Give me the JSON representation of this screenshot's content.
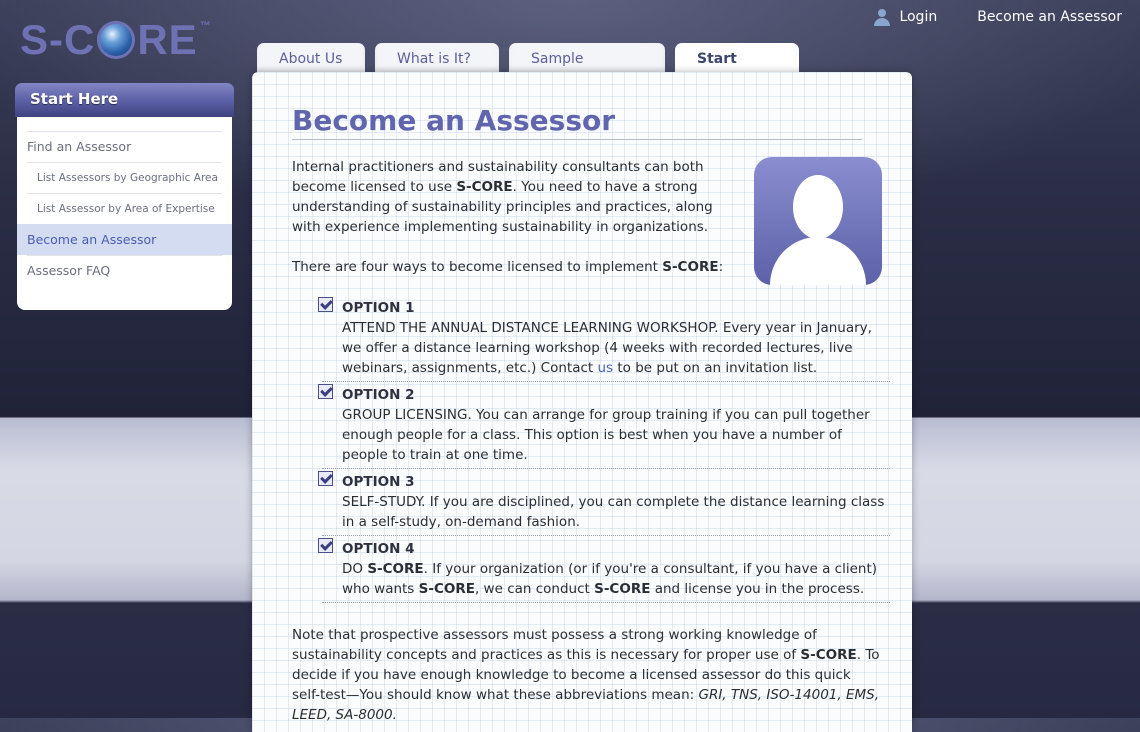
{
  "logo": {
    "prefix": "S-C",
    "suffix": "RE",
    "tm": "™"
  },
  "topnav": {
    "login": "Login",
    "become": "Become an Assessor"
  },
  "tabs": [
    {
      "label": "About Us"
    },
    {
      "label": "What is It?"
    },
    {
      "label": "Sample Assessment"
    },
    {
      "label": "Start Here"
    }
  ],
  "sidebar": {
    "title": "Start Here",
    "items": [
      {
        "label": "Find an Assessor"
      },
      {
        "label": "List Assessors by Geographic Area"
      },
      {
        "label": "List Assessor by Area of Expertise"
      },
      {
        "label": "Become an Assessor"
      },
      {
        "label": "Assessor FAQ"
      }
    ]
  },
  "main": {
    "title": "Become an Assessor",
    "intro": {
      "a": "Internal practitioners and sustainability consultants can both become licensed to use ",
      "brand": "S-CORE",
      "b": ". You need to have a strong understanding of sustainability principles and practices, along with experience implementing sustainability in organizations."
    },
    "four_ways": {
      "a": "There are four ways to become licensed to implement ",
      "brand": "S-CORE",
      "b": ":"
    },
    "options": [
      {
        "title": "OPTION 1",
        "text": "ATTEND THE ANNUAL DISTANCE LEARNING WORKSHOP. Every year in January, we offer a distance learning workshop (4 weeks with recorded lectures, live webinars, assignments, etc.) Contact ",
        "link": "us",
        "text_after": " to be put on an invitation list."
      },
      {
        "title": "OPTION 2",
        "text": "GROUP LICENSING. You can arrange for group training if you can pull together enough people for a class. This option is best when you have a number of people to train at one time."
      },
      {
        "title": "OPTION 3",
        "text": "SELF-STUDY. If you are disciplined, you can complete the distance learning class in a self-study, on-demand fashion."
      },
      {
        "title": "OPTION 4",
        "p1": "DO ",
        "brand": "S-CORE",
        "p2": ". If your organization (or if you're a consultant, if you have a client) who wants ",
        "p3": ", we can conduct ",
        "p4": " and license you in the process."
      }
    ],
    "note": {
      "a": "Note that prospective assessors must possess a strong working knowledge of sustainability concepts and practices as this is necessary for proper use of ",
      "brand": "S-CORE",
      "b": ".  To decide if you have enough knowledge to become a licensed assessor do this quick self-test—You should know what these abbreviations mean: ",
      "abbrev": "GRI, TNS, ISO-14001, EMS, LEED, SA-8000."
    }
  }
}
